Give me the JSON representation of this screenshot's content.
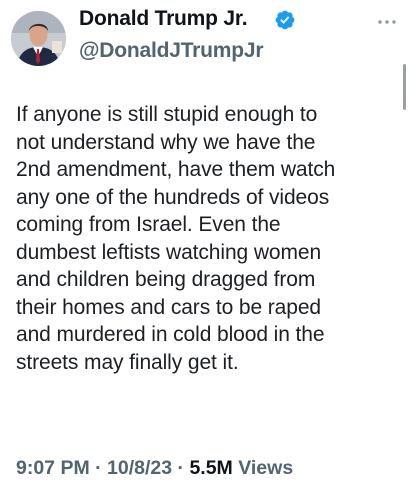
{
  "tweet": {
    "author": {
      "name": "Donald Trump Jr.",
      "handle": "@DonaldJTrumpJr",
      "verified_icon": "verified-badge-icon",
      "verified_color": "#1d9bf0"
    },
    "menu_icon": "more-options-icon",
    "text_lines": [
      "If anyone is still stupid enough to",
      "not understand why we have the",
      "2nd amendment, have them watch",
      "any one of the hundreds of videos",
      "coming from Israel. Even the",
      "dumbest leftists watching women",
      "and children being dragged from",
      "their homes and cars to be raped",
      "and murdered in cold blood in the",
      "streets may finally get it."
    ],
    "meta": {
      "time": "9:07 PM",
      "date": "10/8/23",
      "separator": " · ",
      "views_count": "5.5M",
      "views_label": " Views"
    }
  }
}
